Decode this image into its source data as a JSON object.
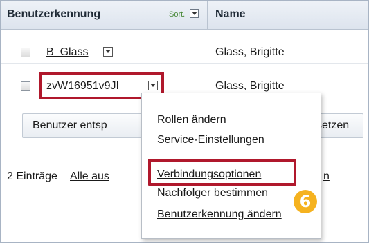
{
  "header": {
    "col_user": "Benutzerkennung",
    "sort_label": "Sort.",
    "col_name": "Name"
  },
  "rows": [
    {
      "user": "B_Glass",
      "name": "Glass, Brigitte"
    },
    {
      "user": "zvW16951v9JI",
      "name": "Glass, Brigitte"
    }
  ],
  "buttons": {
    "left": "Benutzer entsp",
    "right": "setzen"
  },
  "footer": {
    "count": "2 Einträge",
    "select_all": "Alle aus",
    "tail": "n"
  },
  "menu": {
    "items": [
      "Rollen ändern",
      "Service-Einstellungen",
      "Verbindungsoptionen",
      "Nachfolger bestimmen",
      "Benutzerkennung ändern"
    ]
  },
  "callout": {
    "number": "6"
  },
  "colors": {
    "highlight": "#b0182c",
    "badge": "#f5b21f"
  }
}
